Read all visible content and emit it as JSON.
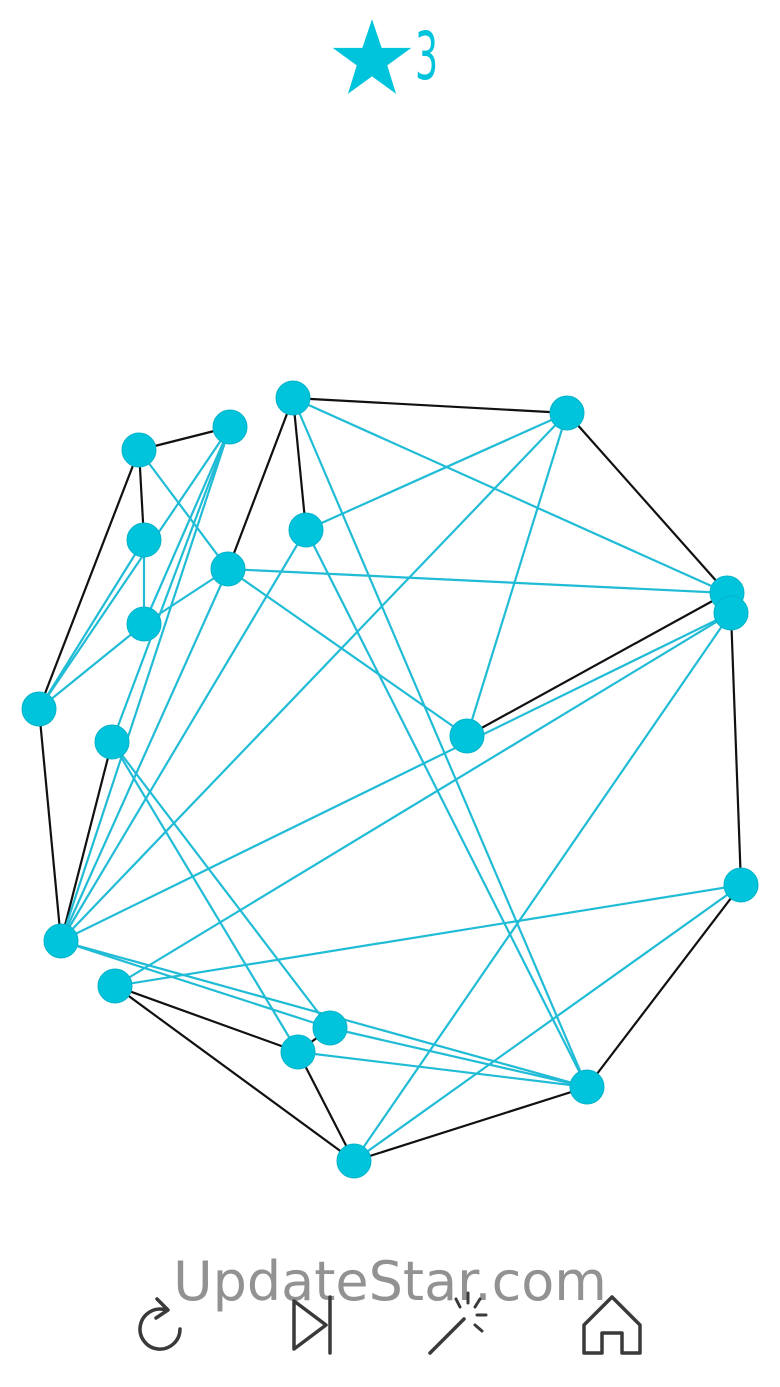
{
  "header": {
    "star_count": "3"
  },
  "colors": {
    "accent": "#00c4dc",
    "node_fill": "#00c4dc",
    "crossing_edge": "#20bcd6",
    "clear_edge": "#111111",
    "toolbar_icon": "#3a3a3a",
    "watermark": "#808080"
  },
  "watermark": {
    "text": "UpdateStar.com"
  },
  "toolbar": {
    "buttons": [
      {
        "name": "restart-button",
        "icon": "restart-icon"
      },
      {
        "name": "skip-level-button",
        "icon": "skip-icon"
      },
      {
        "name": "hint-button",
        "icon": "magic-wand-icon"
      },
      {
        "name": "home-button",
        "icon": "home-icon"
      }
    ]
  }
}
